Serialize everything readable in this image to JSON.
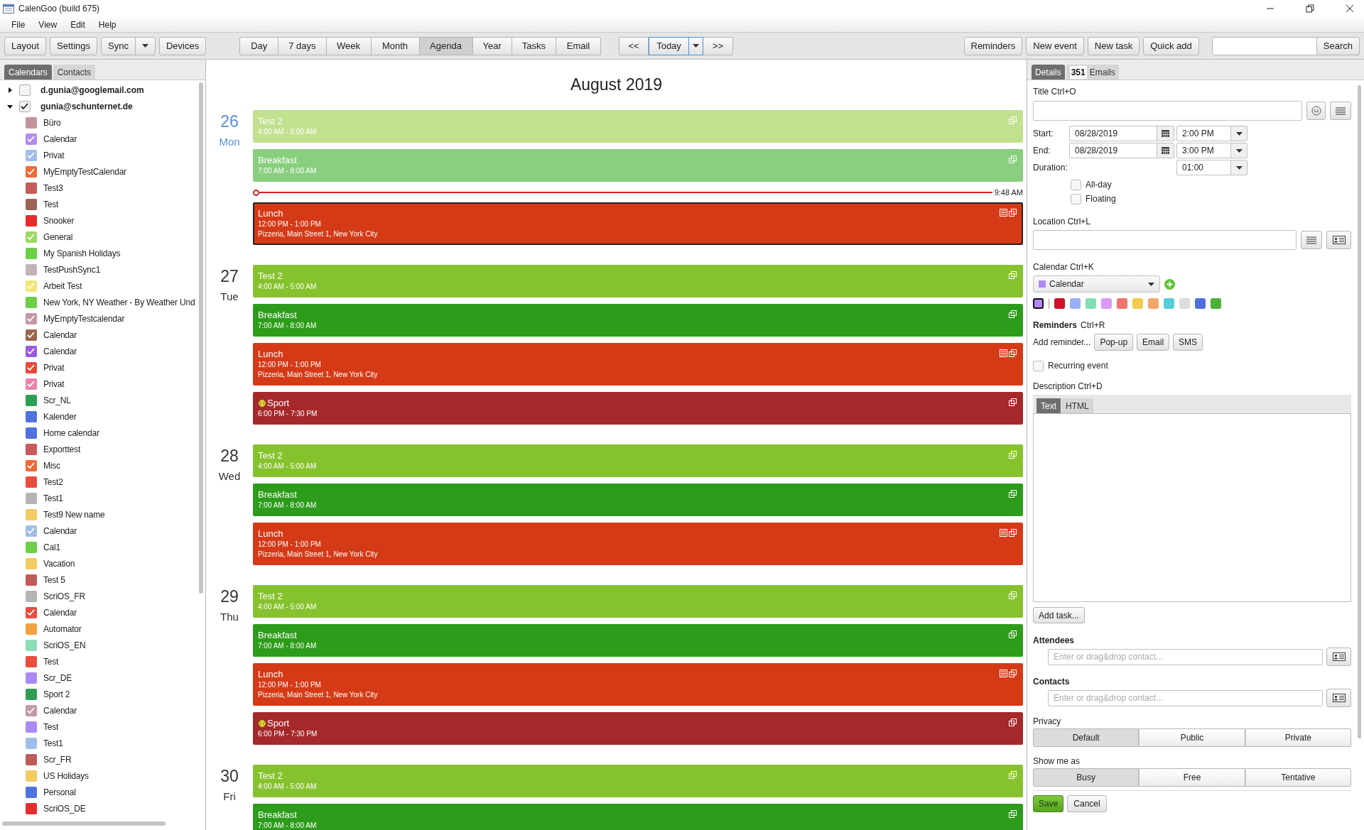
{
  "window": {
    "title": "CalenGoo (build 675)"
  },
  "menu": [
    "File",
    "View",
    "Edit",
    "Help"
  ],
  "toolbar": {
    "left": [
      {
        "label": "Layout",
        "dropdown": false
      },
      {
        "label": "Settings",
        "dropdown": false
      },
      {
        "label": "Sync",
        "dropdown": true
      },
      {
        "label": "Devices",
        "dropdown": false
      }
    ],
    "views": [
      {
        "label": "Day",
        "selected": false
      },
      {
        "label": "7 days",
        "selected": false
      },
      {
        "label": "Week",
        "selected": false
      },
      {
        "label": "Month",
        "selected": false
      },
      {
        "label": "Agenda",
        "selected": true
      },
      {
        "label": "Year",
        "selected": false
      },
      {
        "label": "Tasks",
        "selected": false
      },
      {
        "label": "Email",
        "selected": false
      }
    ],
    "nav": {
      "prev": "<<",
      "today": "Today",
      "next": ">>"
    },
    "actions": [
      "Reminders",
      "New event",
      "New task",
      "Quick add"
    ],
    "search": {
      "button": "Search"
    }
  },
  "sidebar": {
    "tabs": [
      {
        "label": "Calendars",
        "selected": true
      },
      {
        "label": "Contacts",
        "selected": false
      }
    ],
    "accounts": [
      {
        "name": "d.gunia@googlemail.com",
        "expanded": false,
        "checked": false
      },
      {
        "name": "gunia@schunternet.de",
        "expanded": true,
        "checked": true,
        "calendars": [
          {
            "name": "Büro",
            "color": "#c4949d",
            "checked": false
          },
          {
            "name": "Calendar",
            "color": "#b38cf0",
            "checked": true
          },
          {
            "name": "Privat",
            "color": "#9fbfe8",
            "checked": true
          },
          {
            "name": "MyEmptyTestCalendar",
            "color": "#f06a35",
            "checked": true
          },
          {
            "name": "Test3",
            "color": "#c75a5a",
            "checked": false
          },
          {
            "name": "Test",
            "color": "#9c6454",
            "checked": false
          },
          {
            "name": "Snooker",
            "color": "#e52c2c",
            "checked": false
          },
          {
            "name": "General",
            "color": "#9bd864",
            "checked": true
          },
          {
            "name": "My Spanish Holidays",
            "color": "#6ccf46",
            "checked": false
          },
          {
            "name": "TestPushSync1",
            "color": "#c1b3b8",
            "checked": false
          },
          {
            "name": "Arbeit Test",
            "color": "#f2e674",
            "checked": true
          },
          {
            "name": "New York, NY Weather - By Weather Und",
            "color": "#6ccf46",
            "checked": false
          },
          {
            "name": "MyEmptyTestcalendar",
            "color": "#c49aa4",
            "checked": true
          },
          {
            "name": "Calendar",
            "color": "#9a6450",
            "checked": true
          },
          {
            "name": "Calendar",
            "color": "#9b59e0",
            "checked": true
          },
          {
            "name": "Privat",
            "color": "#e8483a",
            "checked": true
          },
          {
            "name": "Privat",
            "color": "#e884ac",
            "checked": true
          },
          {
            "name": "Scr_NL",
            "color": "#2e9e55",
            "checked": false
          },
          {
            "name": "Kalender",
            "color": "#4f72e0",
            "checked": false
          },
          {
            "name": "Home calendar",
            "color": "#4f72e0",
            "checked": false
          },
          {
            "name": "Exporttest",
            "color": "#c75a5a",
            "checked": false
          },
          {
            "name": "Misc",
            "color": "#f06a35",
            "checked": true
          },
          {
            "name": "Test2",
            "color": "#e84c3d",
            "checked": false
          },
          {
            "name": "Test1",
            "color": "#b5b5b5",
            "checked": false
          },
          {
            "name": "Test9 New name",
            "color": "#f2cc60",
            "checked": false
          },
          {
            "name": "Calendar",
            "color": "#9fbfe8",
            "checked": true
          },
          {
            "name": "Cal1",
            "color": "#6ccf46",
            "checked": false
          },
          {
            "name": "Vacation",
            "color": "#f2cc60",
            "checked": false
          },
          {
            "name": "Test 5",
            "color": "#c05a5a",
            "checked": false
          },
          {
            "name": "ScriOS_FR",
            "color": "#b5b5b5",
            "checked": false
          },
          {
            "name": "Calendar",
            "color": "#e84c3d",
            "checked": true
          },
          {
            "name": "Automator",
            "color": "#f2a040",
            "checked": false
          },
          {
            "name": "ScriOS_EN",
            "color": "#8fdcb8",
            "checked": false
          },
          {
            "name": "Test",
            "color": "#e84c3d",
            "checked": false
          },
          {
            "name": "Scr_DE",
            "color": "#a98af5",
            "checked": false
          },
          {
            "name": "Sport 2",
            "color": "#2e9e55",
            "checked": false
          },
          {
            "name": "Calendar",
            "color": "#c49aa4",
            "checked": true
          },
          {
            "name": "Test",
            "color": "#a98af5",
            "checked": false
          },
          {
            "name": "Test1",
            "color": "#9fbfe8",
            "checked": false
          },
          {
            "name": "Scr_FR",
            "color": "#c05a5a",
            "checked": false
          },
          {
            "name": "US Holidays",
            "color": "#f2cc60",
            "checked": false
          },
          {
            "name": "Personal",
            "color": "#4f72e0",
            "checked": false
          },
          {
            "name": "ScriOS_DE",
            "color": "#e52c2c",
            "checked": false
          }
        ]
      }
    ]
  },
  "agenda": {
    "title": "August 2019",
    "days": [
      {
        "day": "26",
        "weekday": "Mon",
        "today": true,
        "items": [
          {
            "kind": "event",
            "title": "Test 2",
            "time": "4:00 AM - 5:00 AM",
            "color": "#c2e18f",
            "selected": false,
            "notes": false
          },
          {
            "kind": "event",
            "title": "Breakfast",
            "time": "7:00 AM - 8:00 AM",
            "color": "#88cf7e",
            "selected": false,
            "notes": false
          },
          {
            "kind": "now",
            "label": "9:48 AM"
          },
          {
            "kind": "event",
            "title": "Lunch",
            "time": "12:00 PM - 1:00 PM",
            "location": "Pizzeria, Main Street 1, New York City",
            "color": "#d53a17",
            "selected": true,
            "notes": true
          }
        ]
      },
      {
        "day": "27",
        "weekday": "Tue",
        "today": false,
        "items": [
          {
            "kind": "event",
            "title": "Test 2",
            "time": "4:00 AM - 5:00 AM",
            "color": "#86c22e",
            "selected": false,
            "notes": false
          },
          {
            "kind": "event",
            "title": "Breakfast",
            "time": "7:00 AM - 8:00 AM",
            "color": "#2d9c1a",
            "selected": false,
            "notes": false
          },
          {
            "kind": "event",
            "title": "Lunch",
            "time": "12:00 PM - 1:00 PM",
            "location": "Pizzeria, Main Street 1, New York City",
            "color": "#d53a17",
            "selected": false,
            "notes": true
          },
          {
            "kind": "event",
            "title": "Sport",
            "time": "6:00 PM - 7:30 PM",
            "color": "#a5282a",
            "selected": false,
            "notes": false,
            "ball": true
          }
        ]
      },
      {
        "day": "28",
        "weekday": "Wed",
        "today": false,
        "items": [
          {
            "kind": "event",
            "title": "Test 2",
            "time": "4:00 AM - 5:00 AM",
            "color": "#86c22e",
            "selected": false,
            "notes": false
          },
          {
            "kind": "event",
            "title": "Breakfast",
            "time": "7:00 AM - 8:00 AM",
            "color": "#2d9c1a",
            "selected": false,
            "notes": false
          },
          {
            "kind": "event",
            "title": "Lunch",
            "time": "12:00 PM - 1:00 PM",
            "location": "Pizzeria, Main Street 1, New York City",
            "color": "#d53a17",
            "selected": false,
            "notes": true
          }
        ]
      },
      {
        "day": "29",
        "weekday": "Thu",
        "today": false,
        "items": [
          {
            "kind": "event",
            "title": "Test 2",
            "time": "4:00 AM - 5:00 AM",
            "color": "#86c22e",
            "selected": false,
            "notes": false
          },
          {
            "kind": "event",
            "title": "Breakfast",
            "time": "7:00 AM - 8:00 AM",
            "color": "#2d9c1a",
            "selected": false,
            "notes": false
          },
          {
            "kind": "event",
            "title": "Lunch",
            "time": "12:00 PM - 1:00 PM",
            "location": "Pizzeria, Main Street 1, New York City",
            "color": "#d53a17",
            "selected": false,
            "notes": true
          },
          {
            "kind": "event",
            "title": "Sport",
            "time": "6:00 PM - 7:30 PM",
            "color": "#a5282a",
            "selected": false,
            "notes": false,
            "ball": true
          }
        ]
      },
      {
        "day": "30",
        "weekday": "Fri",
        "today": false,
        "items": [
          {
            "kind": "event",
            "title": "Test 2",
            "time": "4:00 AM - 5:00 AM",
            "color": "#86c22e",
            "selected": false,
            "notes": false
          },
          {
            "kind": "event",
            "title": "Breakfast",
            "time": "7:00 AM - 8:00 AM",
            "color": "#2d9c1a",
            "selected": false,
            "notes": false
          }
        ]
      }
    ]
  },
  "details": {
    "tabs": [
      {
        "label": "Details",
        "selected": true
      },
      {
        "badge": "351",
        "label": "Emails",
        "selected": false
      }
    ],
    "title_label": "Title Ctrl+O",
    "start": {
      "label": "Start:",
      "date": "08/28/2019",
      "time": "2:00 PM"
    },
    "end": {
      "label": "End:",
      "date": "08/28/2019",
      "time": "3:00 PM"
    },
    "duration": {
      "label": "Duration:",
      "value": "01:00"
    },
    "options": [
      {
        "label": "All-day",
        "checked": false
      },
      {
        "label": "Floating",
        "checked": false
      }
    ],
    "location_label": "Location Ctrl+L",
    "calendar_label": "Calendar Ctrl+K",
    "calendar": {
      "name": "Calendar",
      "color": "#b388f5"
    },
    "colors": [
      {
        "color": "#b388f5",
        "selected": true
      },
      {
        "color": "#d0112b",
        "selected": false
      },
      {
        "color": "#9aaff5",
        "selected": false
      },
      {
        "color": "#7fe0b4",
        "selected": false
      },
      {
        "color": "#d99af5",
        "selected": false
      },
      {
        "color": "#f0766e",
        "selected": false
      },
      {
        "color": "#f2cc4a",
        "selected": false
      },
      {
        "color": "#f2a66a",
        "selected": false
      },
      {
        "color": "#54cfd6",
        "selected": false
      },
      {
        "color": "#dcdcdc",
        "selected": false
      },
      {
        "color": "#4f6fe0",
        "selected": false
      },
      {
        "color": "#4caf3a",
        "selected": false
      }
    ],
    "reminders_label": "Reminders",
    "reminders_shortcut": "Ctrl+R",
    "add_reminder": "Add reminder...",
    "reminder_buttons": [
      "Pop-up",
      "Email",
      "SMS"
    ],
    "recurring": {
      "label": "Recurring event",
      "checked": false
    },
    "description_label": "Description Ctrl+D",
    "description_tabs": [
      {
        "label": "Text",
        "selected": true
      },
      {
        "label": "HTML",
        "selected": false
      }
    ],
    "add_task": "Add task...",
    "attendees": {
      "label": "Attendees",
      "placeholder": "Enter or drag&drop contact..."
    },
    "contacts": {
      "label": "Contacts",
      "placeholder": "Enter or drag&drop contact..."
    },
    "privacy": {
      "label": "Privacy",
      "options": [
        {
          "label": "Default",
          "selected": true
        },
        {
          "label": "Public",
          "selected": false
        },
        {
          "label": "Private",
          "selected": false
        }
      ]
    },
    "show_as": {
      "label": "Show me as",
      "options": [
        {
          "label": "Busy",
          "selected": true
        },
        {
          "label": "Free",
          "selected": false
        },
        {
          "label": "Tentative",
          "selected": false
        }
      ]
    },
    "save": "Save",
    "cancel": "Cancel"
  }
}
